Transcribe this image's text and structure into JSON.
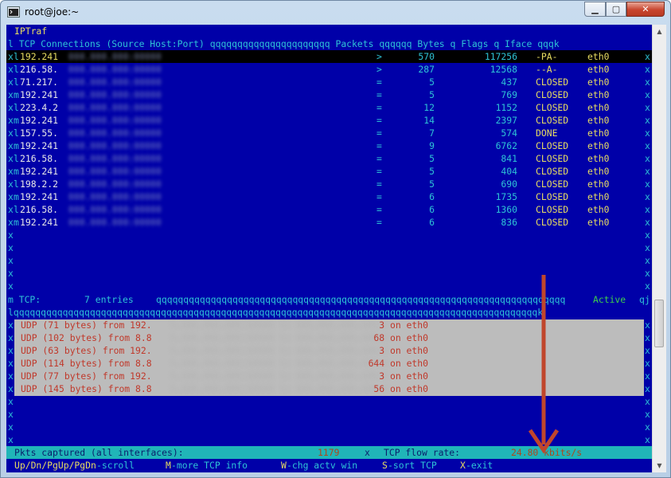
{
  "window": {
    "title": "root@joe:~"
  },
  "header": {
    "app_name": "IPTraf",
    "columns_line": "l TCP Connections (Source Host:Port) qqqqqqqqqqqqqqqqqqqqqq Packets qqqqqq Bytes q Flags q Iface qqqk"
  },
  "connections": [
    {
      "prefix": "x",
      "corner": "l",
      "host": "192.241",
      "dir": ">",
      "packets": "570",
      "bytes": "117256",
      "flags": "-PA-",
      "iface": "eth0",
      "selected": true
    },
    {
      "prefix": "x",
      "corner": "l",
      "host": "216.58.",
      "dir": ">",
      "packets": "287",
      "bytes": "12568",
      "flags": "--A-",
      "iface": "eth0"
    },
    {
      "prefix": "x",
      "corner": "l",
      "host": "71.217.",
      "dir": "=",
      "packets": "5",
      "bytes": "437",
      "flags": "CLOSED",
      "iface": "eth0"
    },
    {
      "prefix": "x",
      "corner": "m",
      "host": "192.241",
      "dir": "=",
      "packets": "5",
      "bytes": "769",
      "flags": "CLOSED",
      "iface": "eth0"
    },
    {
      "prefix": "x",
      "corner": "l",
      "host": "223.4.2",
      "dir": "=",
      "packets": "12",
      "bytes": "1152",
      "flags": "CLOSED",
      "iface": "eth0"
    },
    {
      "prefix": "x",
      "corner": "m",
      "host": "192.241",
      "dir": "=",
      "packets": "14",
      "bytes": "2397",
      "flags": "CLOSED",
      "iface": "eth0"
    },
    {
      "prefix": "x",
      "corner": "l",
      "host": "157.55.",
      "dir": "=",
      "packets": "7",
      "bytes": "574",
      "flags": "DONE",
      "iface": "eth0"
    },
    {
      "prefix": "x",
      "corner": "m",
      "host": "192.241",
      "dir": "=",
      "packets": "9",
      "bytes": "6762",
      "flags": "CLOSED",
      "iface": "eth0"
    },
    {
      "prefix": "x",
      "corner": "l",
      "host": "216.58.",
      "dir": "=",
      "packets": "5",
      "bytes": "841",
      "flags": "CLOSED",
      "iface": "eth0"
    },
    {
      "prefix": "x",
      "corner": "m",
      "host": "192.241",
      "dir": "=",
      "packets": "5",
      "bytes": "404",
      "flags": "CLOSED",
      "iface": "eth0"
    },
    {
      "prefix": "x",
      "corner": "l",
      "host": "198.2.2",
      "dir": "=",
      "packets": "5",
      "bytes": "690",
      "flags": "CLOSED",
      "iface": "eth0"
    },
    {
      "prefix": "x",
      "corner": "m",
      "host": "192.241",
      "dir": "=",
      "packets": "6",
      "bytes": "1735",
      "flags": "CLOSED",
      "iface": "eth0"
    },
    {
      "prefix": "x",
      "corner": "l",
      "host": "216.58.",
      "dir": "=",
      "packets": "6",
      "bytes": "1360",
      "flags": "CLOSED",
      "iface": "eth0"
    },
    {
      "prefix": "x",
      "corner": "m",
      "host": "192.241",
      "dir": "=",
      "packets": "6",
      "bytes": "836",
      "flags": "CLOSED",
      "iface": "eth0"
    }
  ],
  "tcp_summary": {
    "label": "m TCP:",
    "entries": "7 entries",
    "fill": "qqqqqqqqqqqqqqqqqqqqqqqqqqqqqqqqqqqqqqqqqqqqqqqqqqqqqqqqqqqqqqqqqqqqqqqqqqq",
    "state": "Active",
    "end": "qj"
  },
  "lower_border": "lqqqqqqqqqqqqqqqqqqqqqqqqqqqqqqqqqqqqqqqqqqqqqqqqqqqqqqqqqqqqqqqqqqqqqqqqqqqqqqqqqqqqqqqqqqqqqqqqk",
  "udp_packets": [
    {
      "text": "UDP (71 bytes) from 192.",
      "tail": "3 on eth0"
    },
    {
      "text": "UDP (102 bytes) from 8.8",
      "tail": "68 on eth0"
    },
    {
      "text": "UDP (63 bytes) from 192.",
      "tail": "3 on eth0"
    },
    {
      "text": "UDP (114 bytes) from 8.8",
      "tail": "644 on eth0"
    },
    {
      "text": "UDP (77 bytes) from 192.",
      "tail": "3 on eth0"
    },
    {
      "text": "UDP (145 bytes) from 8.8",
      "tail": "56 on eth0"
    }
  ],
  "status_bar": {
    "pkts_label": "Pkts captured (all interfaces):",
    "pkts_value": "1179",
    "sep": "x",
    "rate_label": "TCP flow rate:",
    "rate_value": "24.80 kbits/s"
  },
  "help_bar": [
    {
      "key": "Up/Dn/PgUp/PgDn",
      "desc": "-scroll"
    },
    {
      "key": "M",
      "desc": "-more TCP info"
    },
    {
      "key": "W",
      "desc": "-chg actv win"
    },
    {
      "key": "S",
      "desc": "-sort TCP"
    },
    {
      "key": "X",
      "desc": "-exit"
    }
  ],
  "colors": {
    "terminal_bg": "#0000a8",
    "accent_cyan": "#2ec3d6",
    "accent_yellow": "#e8dd62",
    "annotation_arrow": "#c0462c"
  }
}
